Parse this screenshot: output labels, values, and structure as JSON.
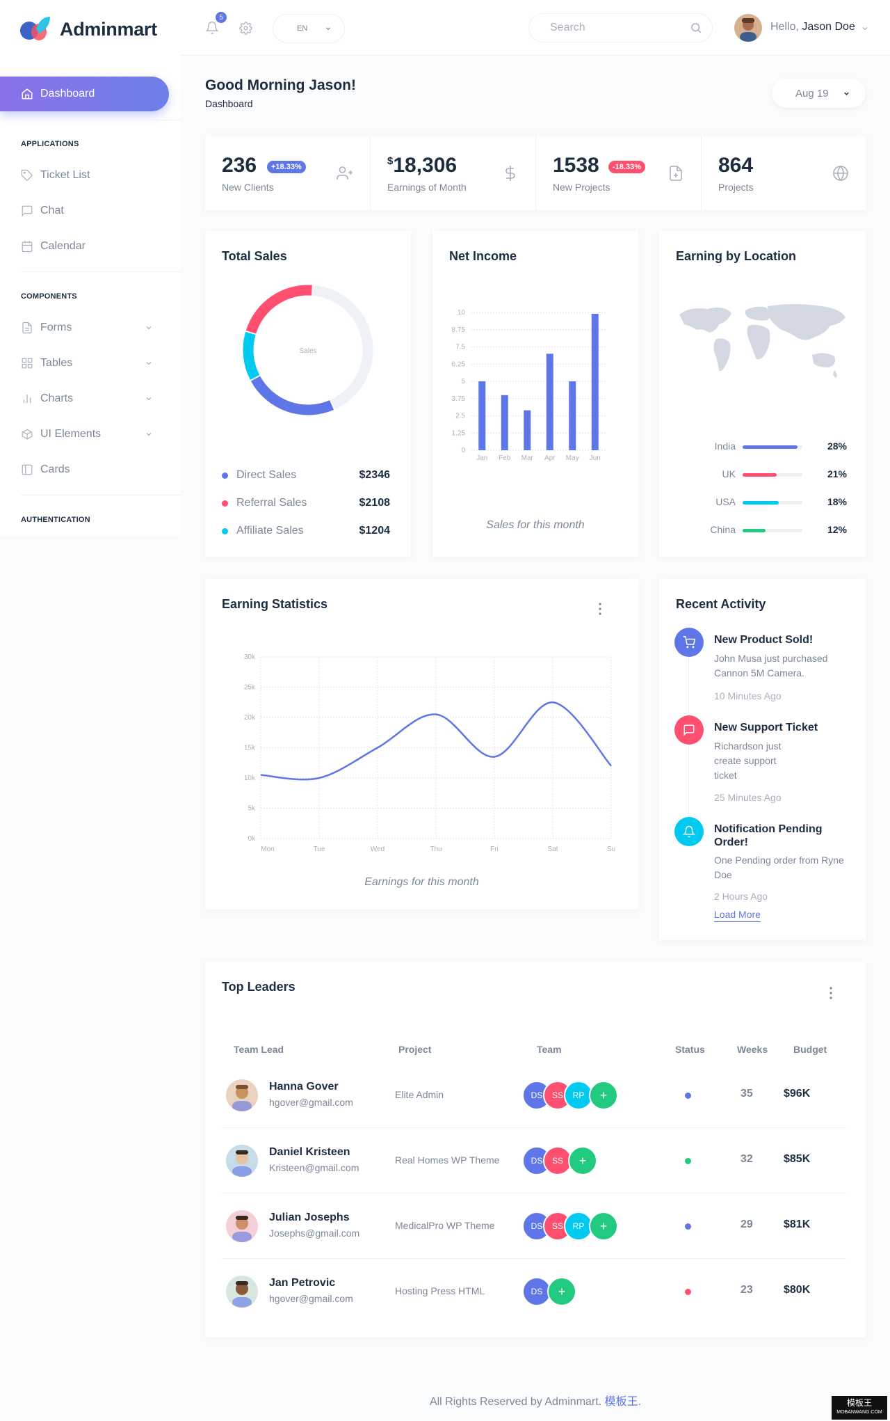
{
  "brand": {
    "name": "Adminmart"
  },
  "sidebar": {
    "active": {
      "label": "Dashboard"
    },
    "sections": [
      "APPLICATIONS",
      "COMPONENTS",
      "AUTHENTICATION"
    ],
    "items": [
      {
        "label": "Ticket List",
        "icon": "tag-icon"
      },
      {
        "label": "Chat",
        "icon": "message-icon"
      },
      {
        "label": "Calendar",
        "icon": "calendar-icon"
      },
      {
        "label": "Forms",
        "icon": "file-icon"
      },
      {
        "label": "Tables",
        "icon": "grid-icon"
      },
      {
        "label": "Charts",
        "icon": "bar-chart-icon"
      },
      {
        "label": "UI Elements",
        "icon": "box-icon"
      },
      {
        "label": "Cards",
        "icon": "sidebar-icon"
      }
    ]
  },
  "topbar": {
    "notification_count": "5",
    "language": "EN",
    "search_placeholder": "Search",
    "hello": "Hello,",
    "user_name": "Jason Doe"
  },
  "page": {
    "greeting": "Good Morning Jason!",
    "breadcrumb": "Dashboard",
    "date": "Aug 19"
  },
  "stats": [
    {
      "value": "236",
      "badge": "+18.33%",
      "label": "New Clients"
    },
    {
      "currency": "$",
      "value": "18,306",
      "label": "Earnings of Month"
    },
    {
      "value": "1538",
      "badge": "-18.33%",
      "label": "New Projects"
    },
    {
      "value": "864",
      "label": "Projects"
    }
  ],
  "colors": {
    "primary": "#5f76e8",
    "danger": "#ff4f70",
    "cyan": "#01caf1",
    "success": "#22ca80",
    "track": "#eef2f7"
  },
  "total_sales": {
    "title": "Total Sales",
    "center_label": "Sales",
    "items": [
      {
        "label": "Direct Sales",
        "value": "$2346",
        "color": "#5f76e8"
      },
      {
        "label": "Referral Sales",
        "value": "$2108",
        "color": "#ff4f70"
      },
      {
        "label": "Affiliate Sales",
        "value": "$1204",
        "color": "#01caf1"
      }
    ]
  },
  "net_income": {
    "title": "Net Income",
    "caption": "Sales for this month"
  },
  "earning_location": {
    "title": "Earning by Location",
    "rows": [
      {
        "country": "India",
        "percent": "28%",
        "fill": 0.92,
        "color": "#5f76e8"
      },
      {
        "country": "UK",
        "percent": "21%",
        "fill": 0.57,
        "color": "#ff4f70"
      },
      {
        "country": "USA",
        "percent": "18%",
        "fill": 0.6,
        "color": "#01caf1"
      },
      {
        "country": "China",
        "percent": "12%",
        "fill": 0.38,
        "color": "#22ca80"
      }
    ]
  },
  "earning_stats": {
    "title": "Earning Statistics",
    "caption": "Earnings for this month"
  },
  "chart_data": [
    {
      "type": "pie",
      "title": "Total Sales",
      "categories": [
        "Direct Sales",
        "Referral Sales",
        "Affiliate Sales",
        "Remaining"
      ],
      "values": [
        2346,
        2108,
        1204,
        4300
      ],
      "center_label": "Sales"
    },
    {
      "type": "bar",
      "title": "Net Income",
      "categories": [
        "Jan",
        "Feb",
        "Mar",
        "Apr",
        "May",
        "Jun"
      ],
      "values": [
        5,
        4,
        2.9,
        7,
        5,
        9.9
      ],
      "ylim": [
        0,
        10
      ],
      "yticks": [
        "0",
        "1.25",
        "2.5",
        "3.75",
        "5",
        "6.25",
        "7.5",
        "8.75",
        "10"
      ],
      "xlabel": "Sales for this month",
      "color": "#5f76e8"
    },
    {
      "type": "line",
      "title": "Earning Statistics",
      "categories": [
        "Mon",
        "Tue",
        "Wed",
        "Thu",
        "Fri",
        "Sat",
        "Su"
      ],
      "values": [
        10500,
        10000,
        15000,
        20500,
        13500,
        22500,
        12000
      ],
      "ylim": [
        0,
        30000
      ],
      "yticks": [
        "0k",
        "5k",
        "10k",
        "15k",
        "20k",
        "25k",
        "30k"
      ],
      "xlabel": "Earnings for this month",
      "grid": true,
      "color": "#5f76e8"
    }
  ],
  "recent_activity": {
    "title": "Recent Activity",
    "items": [
      {
        "title": "New Product Sold!",
        "desc": "John Musa just purchased Cannon 5M Camera.",
        "time": "10 Minutes Ago",
        "color": "#5f76e8",
        "icon": "cart-icon"
      },
      {
        "title": "New Support Ticket",
        "desc": "Richardson just create support ticket",
        "time": "25 Minutes Ago",
        "color": "#ff4f70",
        "icon": "message-icon"
      },
      {
        "title": "Notification Pending Order!",
        "desc": "One Pending order from Ryne Doe",
        "time": "2 Hours Ago",
        "color": "#01caf1",
        "icon": "bell-icon"
      }
    ],
    "load_more": "Load More"
  },
  "top_leaders": {
    "title": "Top Leaders",
    "headers": [
      "Team Lead",
      "Project",
      "Team",
      "Status",
      "Weeks",
      "Budget"
    ],
    "rows": [
      {
        "name": "Hanna Gover",
        "email": "hgover@gmail.com",
        "project": "Elite Admin",
        "team": [
          "DS",
          "SS",
          "RP"
        ],
        "status_color": "#5f76e8",
        "weeks": "35",
        "budget": "$96K"
      },
      {
        "name": "Daniel Kristeen",
        "email": "Kristeen@gmail.com",
        "project": "Real Homes WP Theme",
        "team": [
          "DS",
          "SS"
        ],
        "status_color": "#22ca80",
        "weeks": "32",
        "budget": "$85K"
      },
      {
        "name": "Julian Josephs",
        "email": "Josephs@gmail.com",
        "project": "MedicalPro WP Theme",
        "team": [
          "DS",
          "SS",
          "RP"
        ],
        "status_color": "#5f76e8",
        "weeks": "29",
        "budget": "$81K"
      },
      {
        "name": "Jan Petrovic",
        "email": "hgover@gmail.com",
        "project": "Hosting Press HTML",
        "team": [
          "DS"
        ],
        "status_color": "#ff4f70",
        "weeks": "23",
        "budget": "$80K"
      }
    ],
    "add_label": "+"
  },
  "footer": {
    "text": "All Rights Reserved by Adminmart.",
    "link": "模板王."
  },
  "watermark": {
    "line1": "模板王",
    "line2": "MOBANWANG.COM"
  }
}
